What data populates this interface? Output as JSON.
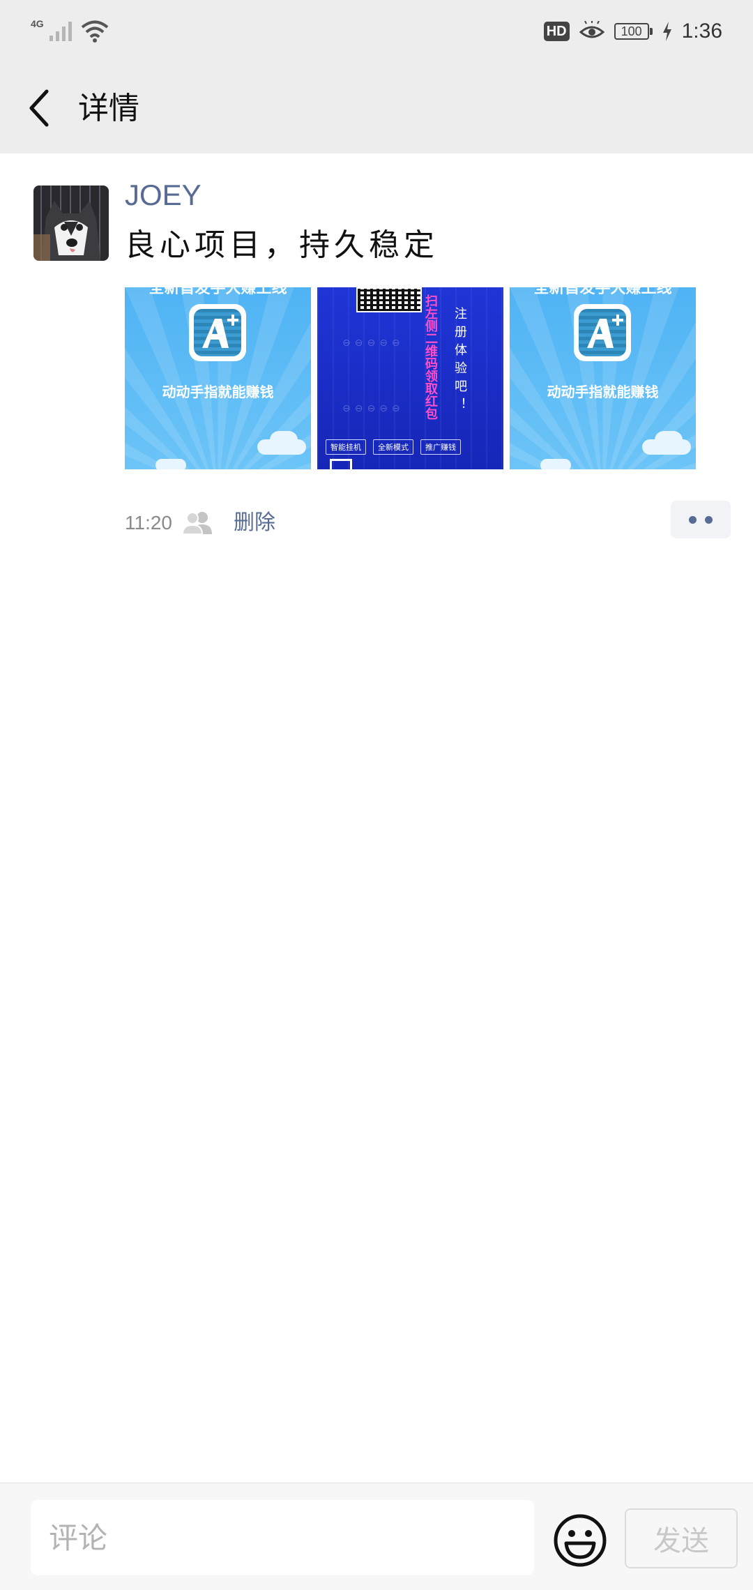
{
  "status_bar": {
    "network": "4G",
    "hd": "HD",
    "battery": "100",
    "time": "1:36"
  },
  "header": {
    "title": "详情"
  },
  "post": {
    "author": "JOEY",
    "text": "良心项目，持久稳定",
    "images": [
      {
        "top_text": "全新首发手大赚上线",
        "caption": "动动手指就能赚钱"
      },
      {
        "side_text_pink": "扫左侧二维码领取红包",
        "side_text_white": "注册体验吧！",
        "buttons": [
          "智能挂机",
          "全新模式",
          "推广赚钱"
        ]
      },
      {
        "top_text": "全新首发手大赚上线",
        "caption": "动动手指就能赚钱"
      }
    ],
    "time": "11:20",
    "delete_label": "删除"
  },
  "comment_bar": {
    "placeholder": "评论",
    "send_label": "发送"
  },
  "colors": {
    "link": "#576b95",
    "bar_bg": "#ededed"
  }
}
